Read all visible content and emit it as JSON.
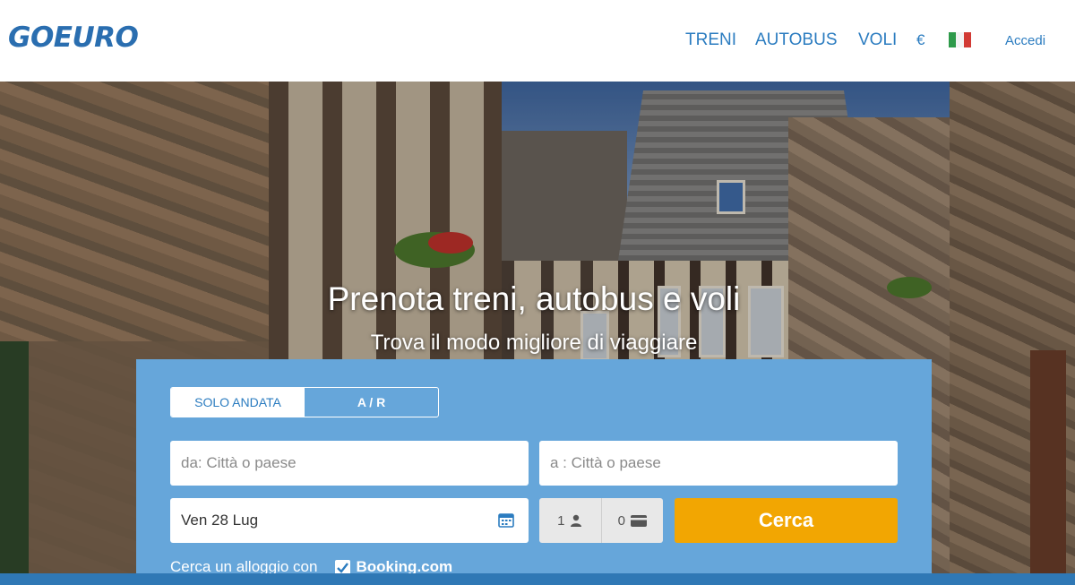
{
  "header": {
    "logo": "GOEURO",
    "nav": {
      "trains": "TRENI",
      "bus": "AUTOBUS",
      "flights": "VOLI"
    },
    "currency": "€",
    "language_flag_icon": "italy-flag-icon",
    "login": "Accedi",
    "colors": {
      "link": "#2b7cc0",
      "logo": "#2a6eb0"
    }
  },
  "hero": {
    "title": "Prenota treni, autobus e voli",
    "subtitle": "Trova il modo migliore di viaggiare"
  },
  "search": {
    "trip_type": {
      "one_way": "SOLO ANDATA",
      "return": "A / R",
      "selected": "SOLO ANDATA"
    },
    "from": {
      "value": "",
      "placeholder": "da:  Città o paese"
    },
    "to": {
      "value": "",
      "placeholder": "a :  Città o paese"
    },
    "date": {
      "value": "Ven 28 Lug",
      "icon": "calendar-icon"
    },
    "passengers": {
      "count": "1",
      "icon": "person-icon"
    },
    "discount_cards": {
      "count": "0",
      "icon": "card-icon"
    },
    "submit_label": "Cerca",
    "accommodation": {
      "label": "Cerca un alloggio con",
      "brand": "Booking.com",
      "checked": true
    },
    "colors": {
      "panel": "#66a6da",
      "button": "#f2a602"
    }
  }
}
